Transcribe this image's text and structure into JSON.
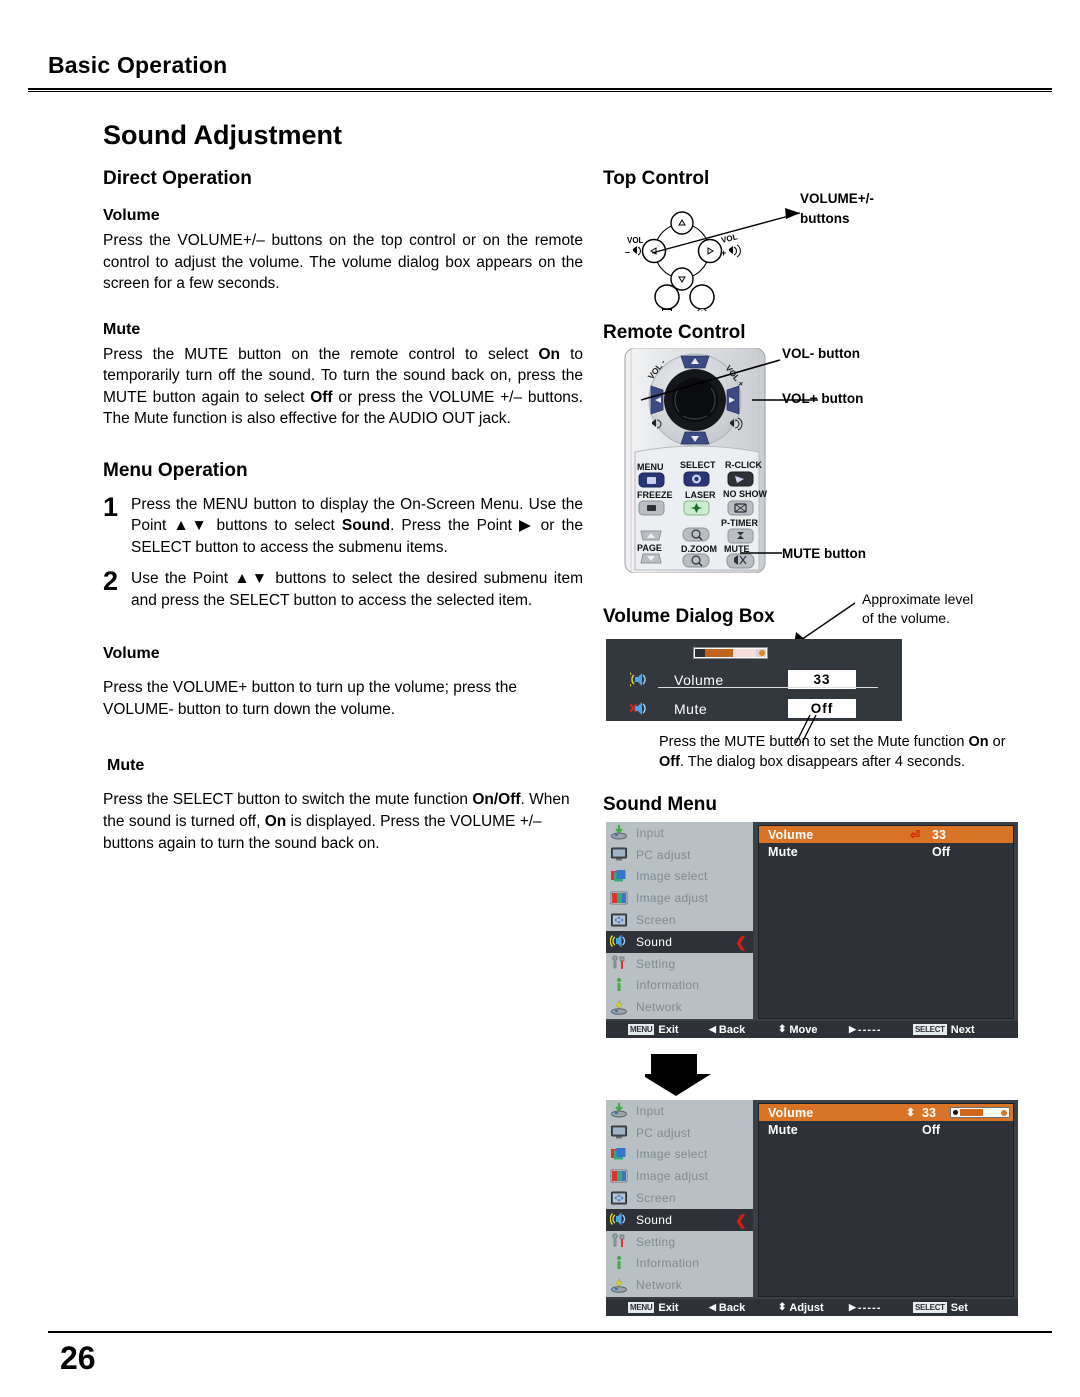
{
  "header": {
    "chapter": "Basic Operation",
    "page_number": "26"
  },
  "title": "Sound Adjustment",
  "left": {
    "direct_operation": {
      "heading": "Direct Operation",
      "volume": {
        "heading": "Volume",
        "text": "Press the VOLUME+/– buttons on the top control or on the remote control to adjust the volume. The volume dialog box appears on the screen for a few seconds."
      },
      "mute": {
        "heading": "Mute",
        "text_1": "Press the MUTE button on the remote control to select ",
        "bold_1": "On",
        "text_2": " to temporarily turn off the sound. To turn the sound back on, press the MUTE button again to select ",
        "bold_2": "Off",
        "text_3": " or press the VOLUME +/– buttons. The Mute function is also effective for the AUDIO OUT jack."
      }
    },
    "menu_operation": {
      "heading": "Menu Operation",
      "steps": [
        {
          "num": "1",
          "text_1": "Press the MENU button to display the On-Screen Menu. Use the Point ▲▼ buttons to select ",
          "bold_1": "Sound",
          "text_2": ". Press the Point ▶ or the SELECT button to access the submenu items."
        },
        {
          "num": "2",
          "text_1": "Use the Point ▲▼ buttons to select the desired submenu item and press the SELECT button to access the selected item.",
          "bold_1": "",
          "text_2": ""
        }
      ]
    },
    "volume_detail": {
      "heading": "Volume",
      "text": "Press the VOLUME+ button to turn up the volume; press the VOLUME- button to turn down the volume."
    },
    "mute_detail": {
      "heading": "Mute",
      "text_1": "Press the SELECT button to switch the mute function ",
      "bold_1": "On/Off",
      "text_2": ". When the sound is turned off, ",
      "bold_2": "On",
      "text_3": " is displayed. Press the VOLUME +/– buttons again to turn the sound back on."
    }
  },
  "right": {
    "top_control": {
      "heading": "Top Control",
      "callout": "VOLUME+/-\nbuttons",
      "callout_line1": "VOLUME+/-",
      "callout_line2": "buttons",
      "label_vol_minus": "VOL",
      "label_vol_plus": "VOL"
    },
    "remote_control": {
      "heading": "Remote Control",
      "callouts": [
        "VOL- button",
        "VOL+ button",
        "MUTE button"
      ],
      "dial_labels": {
        "left": "VOL -",
        "right": "VOL +"
      },
      "buttons": [
        "MENU",
        "SELECT",
        "R-CLICK",
        "FREEZE",
        "LASER",
        "NO SHOW",
        "P-TIMER",
        "PAGE",
        "D.ZOOM",
        "MUTE"
      ]
    },
    "volume_dialog": {
      "heading": "Volume Dialog Box",
      "callout_top_line1": "Approximate level",
      "callout_top_line2": "of the volume.",
      "rows": [
        {
          "icon": "speaker-wave-icon",
          "label": "Volume",
          "value": "33"
        },
        {
          "icon": "speaker-mute-icon",
          "label": "Mute",
          "value": "Off"
        }
      ],
      "note_1": "Press the MUTE button to set the Mute function ",
      "note_bold_1": "On",
      "note_2": " or ",
      "note_bold_2": "Off",
      "note_3": ". The dialog box disappears after 4 seconds."
    },
    "sound_menu": {
      "heading": "Sound Menu",
      "sidebar": [
        {
          "label": "Input",
          "icon": "input-icon",
          "selected": false
        },
        {
          "label": "PC adjust",
          "icon": "monitor-icon",
          "selected": false
        },
        {
          "label": "Image select",
          "icon": "image-select-icon",
          "selected": false
        },
        {
          "label": "Image adjust",
          "icon": "image-adjust-icon",
          "selected": false
        },
        {
          "label": "Screen",
          "icon": "screen-icon",
          "selected": false
        },
        {
          "label": "Sound",
          "icon": "sound-icon",
          "selected": true
        },
        {
          "label": "Setting",
          "icon": "setting-icon",
          "selected": false
        },
        {
          "label": "Information",
          "icon": "information-icon",
          "selected": false
        },
        {
          "label": "Network",
          "icon": "network-icon",
          "selected": false
        }
      ],
      "menu_1": {
        "rows": [
          {
            "label": "Volume",
            "value": "33",
            "highlighted": true,
            "marker": "enter-arrow-icon"
          },
          {
            "label": "Mute",
            "value": "Off",
            "highlighted": false,
            "marker": ""
          }
        ],
        "bottom_bar": [
          {
            "badge": "MENU",
            "label": "Exit"
          },
          {
            "badge": "",
            "glyph": "◀",
            "label": "Back"
          },
          {
            "badge": "",
            "glyph": "⬍",
            "label": "Move"
          },
          {
            "badge": "",
            "glyph": "▶",
            "label": "- - - - -"
          },
          {
            "badge": "SELECT",
            "label": "Next"
          }
        ]
      },
      "menu_2": {
        "rows": [
          {
            "label": "Volume",
            "value": "33",
            "highlighted": true,
            "marker": "updown-arrow-icon",
            "slider": 38
          },
          {
            "label": "Mute",
            "value": "Off",
            "highlighted": false,
            "marker": ""
          }
        ],
        "bottom_bar": [
          {
            "badge": "MENU",
            "label": "Exit"
          },
          {
            "badge": "",
            "glyph": "◀",
            "label": "Back"
          },
          {
            "badge": "",
            "glyph": "⬍",
            "label": "Adjust"
          },
          {
            "badge": "",
            "glyph": "▶",
            "label": "- - - - -"
          },
          {
            "badge": "SELECT",
            "label": "Set"
          }
        ]
      }
    }
  },
  "colors": {
    "highlight_orange": "#d97426",
    "osd_dark": "#2e3238",
    "osd_sidebar": "#b9c0c4",
    "dialog_bg": "#33383f",
    "red_arrow": "#e01b10"
  }
}
